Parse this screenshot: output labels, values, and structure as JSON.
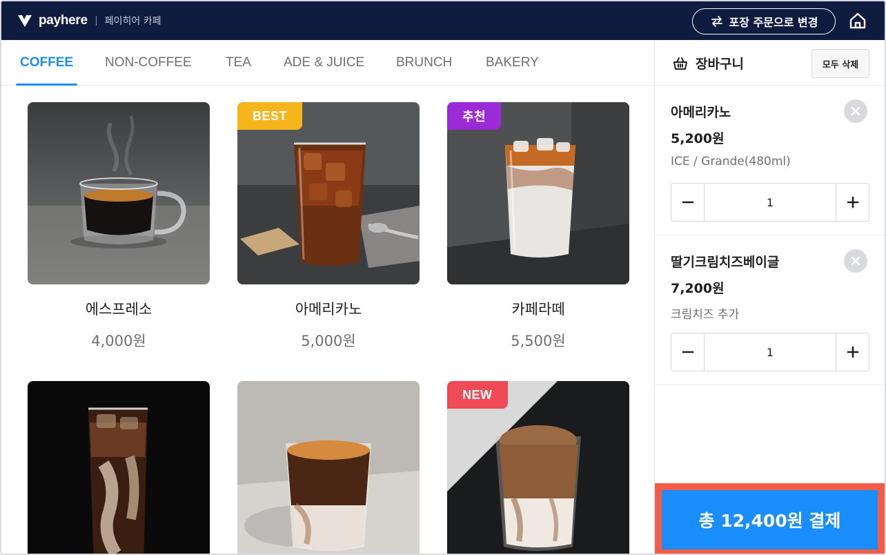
{
  "header": {
    "brand": "payhere",
    "store_name": "페이히어 카페",
    "takeout_label": "포장 주문으로 변경"
  },
  "tabs": [
    {
      "label": "COFFEE",
      "active": true
    },
    {
      "label": "NON-COFFEE",
      "active": false
    },
    {
      "label": "TEA",
      "active": false
    },
    {
      "label": "ADE & JUICE",
      "active": false
    },
    {
      "label": "BRUNCH",
      "active": false
    },
    {
      "label": "BAKERY",
      "active": false
    }
  ],
  "menu": [
    {
      "name": "에스프레소",
      "price": "4,000원",
      "badge": ""
    },
    {
      "name": "아메리카노",
      "price": "5,000원",
      "badge": "BEST"
    },
    {
      "name": "카페라떼",
      "price": "5,500원",
      "badge": "추천"
    },
    {
      "name": "",
      "price": "",
      "badge": ""
    },
    {
      "name": "",
      "price": "",
      "badge": ""
    },
    {
      "name": "",
      "price": "",
      "badge": "NEW"
    }
  ],
  "cart": {
    "title": "장바구니",
    "clear_label": "모두 삭제",
    "items": [
      {
        "name": "아메리카노",
        "price": "5,200원",
        "option": "ICE / Grande(480ml)",
        "qty": "1"
      },
      {
        "name": "딸기크림치즈베이글",
        "price": "7,200원",
        "option": "크림치즈 추가",
        "qty": "1"
      }
    ],
    "pay_label": "총 12,400원 결제"
  },
  "colors": {
    "header_bg": "#0f1c3f",
    "accent": "#1a8dff",
    "pay_highlight": "#f25c48",
    "badge_best": "#f7b51c",
    "badge_recommend": "#9b2bd6",
    "badge_new": "#f04a57"
  },
  "icons": {
    "logo": "payhere-logo-icon",
    "takeout": "swap-arrows-icon",
    "home": "home-icon",
    "cart": "basket-icon",
    "remove": "close-circle-icon",
    "minus": "minus-icon",
    "plus": "plus-icon"
  }
}
